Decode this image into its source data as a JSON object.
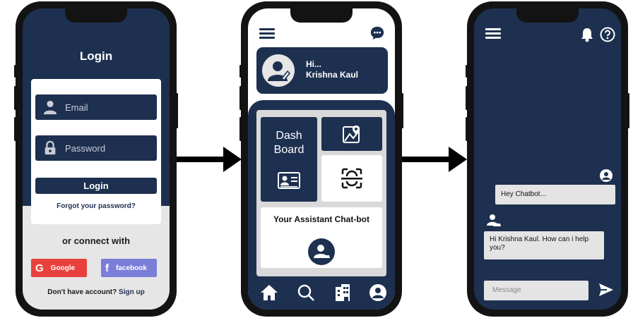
{
  "login_screen": {
    "title": "Login",
    "email_placeholder": "Email",
    "password_placeholder": "Password",
    "login_button": "Login",
    "forgot_link": "Forgot your password?",
    "or_connect": "or connect with",
    "google_label": "Google",
    "facebook_label": "facebook",
    "no_account_text": "Don't have account?",
    "signup_link": "Sign up"
  },
  "home_screen": {
    "greeting": "Hi...",
    "user_name": "Krishna Kaul",
    "dashboard_line1": "Dash",
    "dashboard_line2": "Board",
    "assistant_label": "Your Assistant Chat-bot"
  },
  "chat_screen": {
    "user_message": "Hey Chatbot...",
    "bot_message": "Hi Krishna Kaul. How can i help you?",
    "message_placeholder": "Message"
  },
  "colors": {
    "navy": "#1e3050",
    "google_red": "#e8413c",
    "facebook_purple": "#7a7ed8",
    "light_grey": "#e4e4e4"
  },
  "icons": [
    "user-icon",
    "lock-icon",
    "hamburger-menu-icon",
    "chat-bubble-icon",
    "avatar-icon",
    "map-icon",
    "id-card-icon",
    "face-scan-icon",
    "bot-icon",
    "home-icon",
    "search-icon",
    "building-icon",
    "profile-icon",
    "bell-icon",
    "help-icon",
    "send-icon"
  ]
}
